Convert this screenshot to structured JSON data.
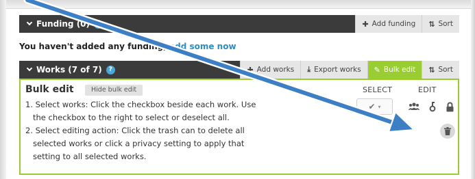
{
  "funding": {
    "title": "Funding (0)",
    "help": "?",
    "add_label": "Add funding",
    "sort_label": "Sort",
    "empty_prefix": "You haven't added any funding, ",
    "empty_link": "add some now"
  },
  "works": {
    "title": "Works (7 of 7)",
    "help": "?",
    "add_label": "Add works",
    "export_label": "Export works",
    "bulk_label": "Bulk edit",
    "sort_label": "Sort"
  },
  "bulk": {
    "title": "Bulk edit",
    "hide_label": "Hide bulk edit",
    "select_label": "SELECT",
    "edit_label": "EDIT",
    "instructions": [
      "1. Select works: Click the checkbox beside each work. Use the checkbox to the right to select or deselect all.",
      "2. Select editing action: Click the trash can to delete all selected works or click a privacy setting to apply that setting to all selected works."
    ]
  },
  "icons": {
    "add": "plus-icon",
    "export": "download-icon",
    "bulk": "pencil-icon",
    "sort": "sort-icon",
    "check": "checkmark-icon",
    "everyone": "group-icon",
    "trusted": "key-icon",
    "private": "lock-icon",
    "trash": "trash-icon"
  },
  "colors": {
    "header_bar": "#3b3b3b",
    "accent_green": "#9acd32",
    "link_blue": "#2e8cc6",
    "arrow_blue": "#3d7fc4"
  }
}
